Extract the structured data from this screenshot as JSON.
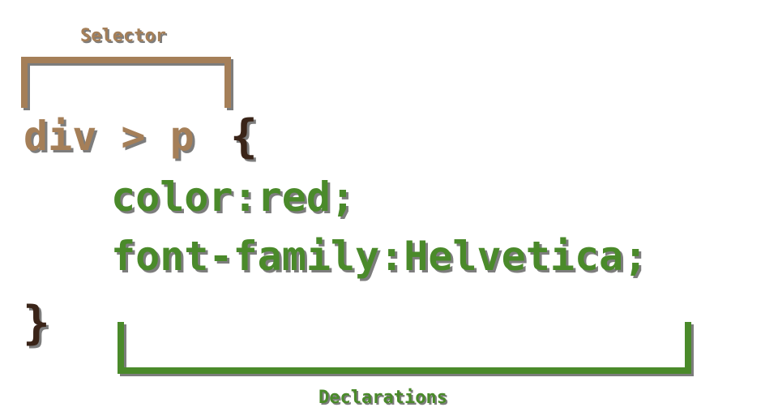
{
  "diagram": {
    "selector_label": "Selector",
    "declarations_label": "Declarations",
    "selector_code": "div > p",
    "open_brace": "{",
    "close_brace": "}",
    "declarations": [
      "color:red;",
      "font-family:Helvetica;"
    ]
  },
  "colors": {
    "selector": "#a57f58",
    "declarations": "#4a8a2a",
    "braces": "#3a2418",
    "shadow": "#7d7d7d",
    "background": "#ffffff"
  }
}
